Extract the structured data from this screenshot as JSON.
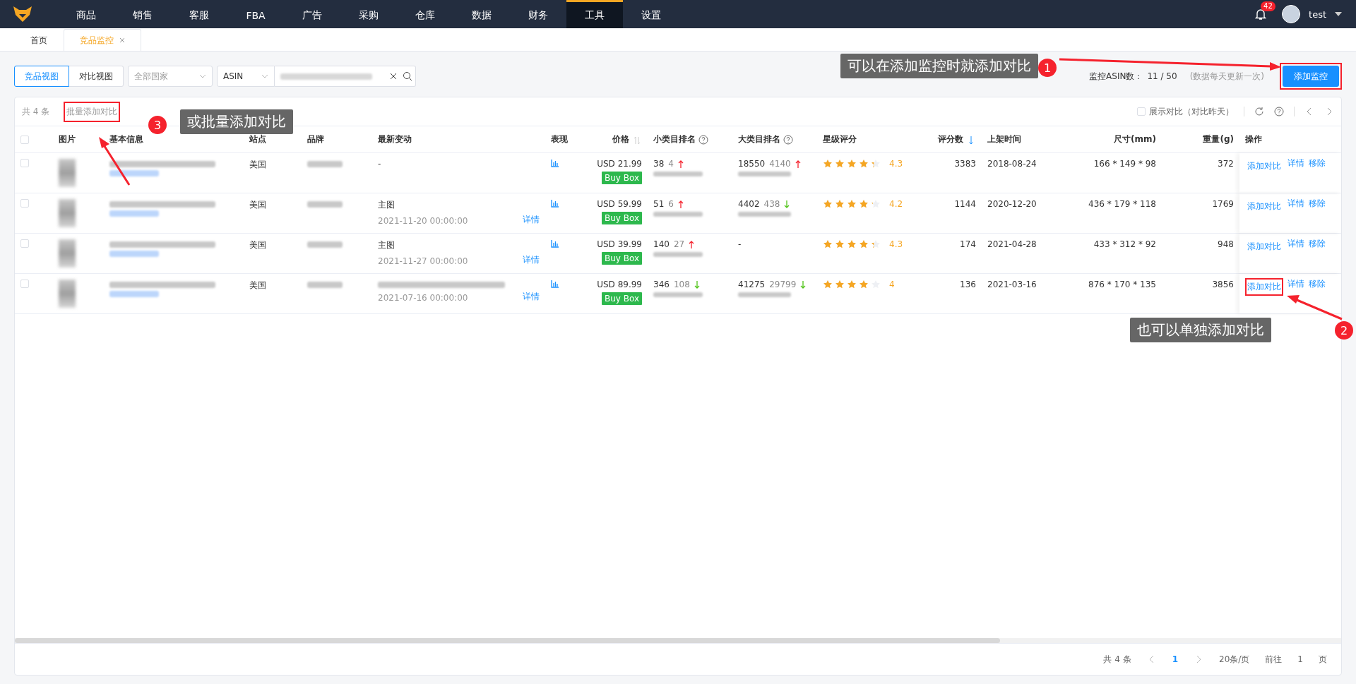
{
  "nav": {
    "items": [
      {
        "label": "商品",
        "selected": false
      },
      {
        "label": "销售",
        "selected": false
      },
      {
        "label": "客服",
        "selected": false
      },
      {
        "label": "FBA",
        "selected": false
      },
      {
        "label": "广告",
        "selected": false
      },
      {
        "label": "采购",
        "selected": false
      },
      {
        "label": "仓库",
        "selected": false
      },
      {
        "label": "数据",
        "selected": false
      },
      {
        "label": "财务",
        "selected": false
      },
      {
        "label": "工具",
        "selected": true
      },
      {
        "label": "设置",
        "selected": false
      }
    ],
    "notifications": "42",
    "user": "test"
  },
  "tabs": [
    {
      "label": "首页",
      "selected": false,
      "closable": false
    },
    {
      "label": "竞品监控",
      "selected": true,
      "closable": true
    }
  ],
  "filters": {
    "views": [
      {
        "label": "竞品视图",
        "selected": true
      },
      {
        "label": "对比视图",
        "selected": false
      }
    ],
    "country": {
      "placeholder": "全部国家"
    },
    "search_type": "ASIN"
  },
  "quota": {
    "label": "监控ASIN数：",
    "value": "11 / 50",
    "note": "(数据每天更新一次)"
  },
  "add_button": {
    "label": "添加监控",
    "highlighted": true
  },
  "table_toolbar": {
    "count": "共 4 条",
    "batch_compare": {
      "label": "批量添加对比",
      "highlighted": true
    },
    "show_compare": {
      "label": "展示对比（对比昨天）",
      "checked": false
    }
  },
  "select_all": {
    "checked": false
  },
  "columns": [
    {
      "label": "图片",
      "kind": "plain"
    },
    {
      "label": "基本信息",
      "kind": "plain"
    },
    {
      "label": "站点",
      "kind": "plain"
    },
    {
      "label": "品牌",
      "kind": "plain"
    },
    {
      "label": "最新变动",
      "kind": "plain"
    },
    {
      "label": "表现",
      "kind": "plain"
    },
    {
      "label": "价格",
      "kind": "sort"
    },
    {
      "label": "小类目排名",
      "kind": "help"
    },
    {
      "label": "大类目排名",
      "kind": "help"
    },
    {
      "label": "星级评分",
      "kind": "plain"
    },
    {
      "label": "评分数",
      "kind": "sort-desc"
    },
    {
      "label": "上架时间",
      "kind": "plain"
    },
    {
      "label": "尺寸(mm)",
      "kind": "plain"
    },
    {
      "label": "重量(g)",
      "kind": "plain"
    },
    {
      "label": "操作",
      "kind": "plain"
    }
  ],
  "rows": [
    {
      "checked": false,
      "site": "美国",
      "change": {
        "kind": "text",
        "text": "-"
      },
      "price": "USD 21.99",
      "badge": "Buy Box",
      "small_rank": {
        "value": "38",
        "delta": "4",
        "rising": true
      },
      "big_rank": {
        "value": "18550",
        "delta": "4140",
        "rising": true
      },
      "stars": 4.3,
      "rating": "4.3",
      "reviews": "3383",
      "listed": "2018-08-24",
      "size": "166 * 149 * 98",
      "weight": "372",
      "actions": [
        "添加对比",
        "详情",
        "移除"
      ],
      "compare_highlighted": false
    },
    {
      "checked": false,
      "site": "美国",
      "change": {
        "kind": "text",
        "text": "主图",
        "date": "2021-11-20 00:00:00",
        "link": "详情"
      },
      "price": "USD 59.99",
      "badge": "Buy Box",
      "small_rank": {
        "value": "51",
        "delta": "6",
        "rising": true
      },
      "big_rank": {
        "value": "4402",
        "delta": "438",
        "rising": false
      },
      "stars": 4.2,
      "rating": "4.2",
      "reviews": "1144",
      "listed": "2020-12-20",
      "size": "436 * 179 * 118",
      "weight": "1769",
      "actions": [
        "添加对比",
        "详情",
        "移除"
      ],
      "compare_highlighted": false
    },
    {
      "checked": false,
      "site": "美国",
      "change": {
        "kind": "text",
        "text": "主图",
        "date": "2021-11-27 00:00:00",
        "link": "详情"
      },
      "price": "USD 39.99",
      "badge": "Buy Box",
      "small_rank": {
        "value": "140",
        "delta": "27",
        "rising": true
      },
      "big_rank": {
        "value": "-"
      },
      "stars": 4.3,
      "rating": "4.3",
      "reviews": "174",
      "listed": "2021-04-28",
      "size": "433 * 312 * 92",
      "weight": "948",
      "actions": [
        "添加对比",
        "详情",
        "移除"
      ],
      "compare_highlighted": false
    },
    {
      "checked": false,
      "site": "美国",
      "change": {
        "kind": "blurred",
        "date": "2021-07-16 00:00:00",
        "link": "详情"
      },
      "price": "USD 89.99",
      "badge": "Buy Box",
      "small_rank": {
        "value": "346",
        "delta": "108",
        "rising": false
      },
      "big_rank": {
        "value": "41275",
        "delta": "29799",
        "rising": false
      },
      "stars": 4,
      "rating": "4",
      "reviews": "136",
      "listed": "2021-03-16",
      "size": "876 * 170 * 135",
      "weight": "3856",
      "actions": [
        "添加对比",
        "详情",
        "移除"
      ],
      "compare_highlighted": true
    }
  ],
  "pagination": {
    "total": "共 4 条",
    "page": "1",
    "page_size": "20条/页",
    "goto_label": "前往",
    "goto_value": "1",
    "goto_suffix": "页"
  },
  "annotations": [
    {
      "number": "1",
      "text": "可以在添加监控时就添加对比"
    },
    {
      "number": "2",
      "text": "也可以单独添加对比"
    },
    {
      "number": "3",
      "text": "或批量添加对比"
    }
  ]
}
